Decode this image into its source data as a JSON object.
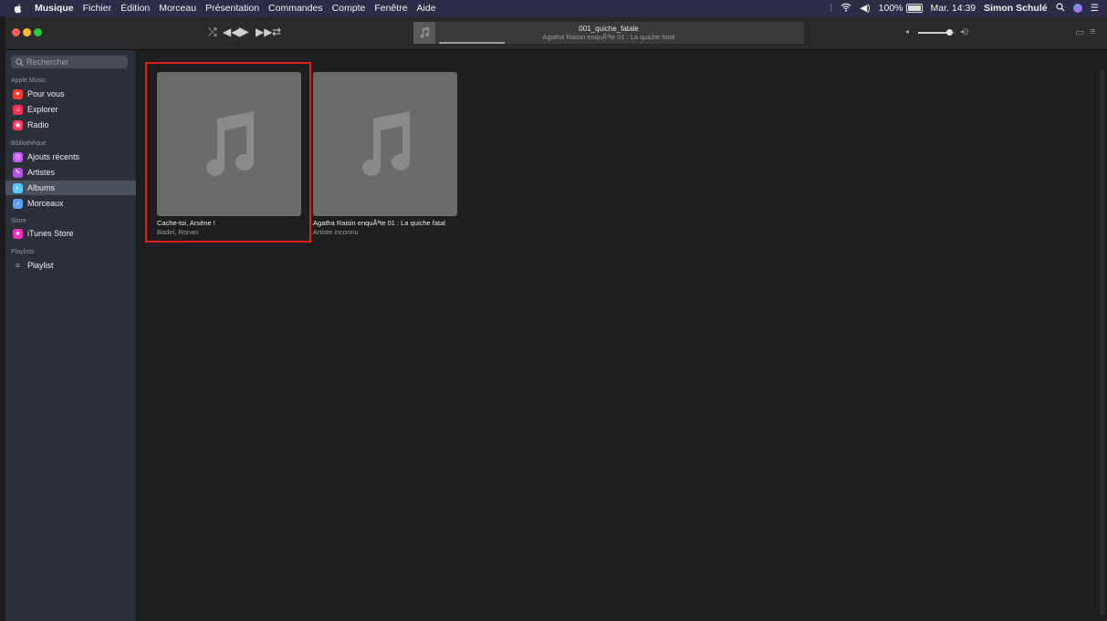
{
  "menubar": {
    "items": [
      "Musique",
      "Fichier",
      "Édition",
      "Morceau",
      "Présentation",
      "Commandes",
      "Compte",
      "Fenêtre",
      "Aide"
    ],
    "battery": "100%",
    "clock": "Mar. 14:39",
    "user": "Simon Schulé"
  },
  "now_playing": {
    "title": "001_quiche_fatale",
    "subtitle": "Agatha Raisin enquÃªte 01 : La quiche fatal",
    "progress": 0.18
  },
  "volume": {
    "level": 0.85
  },
  "sidebar": {
    "search_placeholder": "Rechercher",
    "sections": [
      {
        "title": "Apple Music",
        "items": [
          {
            "label": "Pour vous",
            "icon": "heart-icon",
            "color": "#ff3b30"
          },
          {
            "label": "Explorer",
            "icon": "music-note-icon",
            "color": "#ff2d55"
          },
          {
            "label": "Radio",
            "icon": "radio-icon",
            "color": "#ff375f"
          }
        ]
      },
      {
        "title": "Bibliothèque",
        "items": [
          {
            "label": "Ajouts récents",
            "icon": "clock-icon",
            "color": "#bf5af2"
          },
          {
            "label": "Artistes",
            "icon": "microphone-icon",
            "color": "#af52de"
          },
          {
            "label": "Albums",
            "icon": "album-icon",
            "color": "#5ac8fa",
            "selected": true
          },
          {
            "label": "Morceaux",
            "icon": "song-note-icon",
            "color": "#5e9cf0"
          }
        ]
      },
      {
        "title": "Store",
        "items": [
          {
            "label": "iTunes Store",
            "icon": "star-icon",
            "color": "#f02fc2"
          }
        ]
      },
      {
        "title": "Playlists",
        "items": [
          {
            "label": "Playlist",
            "icon": "playlist-icon",
            "color": "transparent"
          }
        ]
      }
    ]
  },
  "albums": [
    {
      "title": "Cache-toi, Arsène !",
      "artist": "Badel, Ronan",
      "highlighted": true
    },
    {
      "title": "Agatha Raisin enquÃªte 01 : La quiche fatal",
      "artist": "Artiste inconnu",
      "highlighted": false
    }
  ],
  "colors": {
    "accent_highlight": "#e0201c",
    "album_placeholder": "#6b6b6b"
  }
}
